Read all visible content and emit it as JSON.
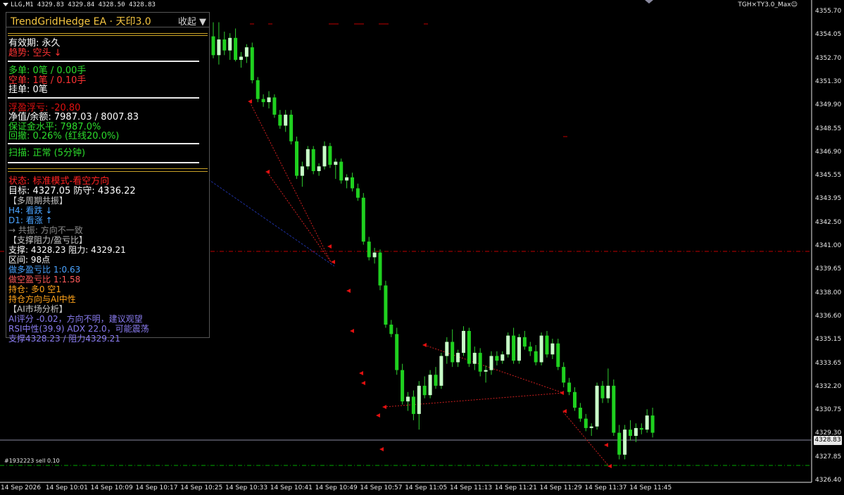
{
  "window": {
    "symbol_line": "LLG,M1  4329.83 4329.84 4328.50 4328.83",
    "indicator_label": "TGH×TY3.0_Max☺"
  },
  "colors": {
    "background": "#000000",
    "bull_candle": "#c8ffc8",
    "bear_candle": "#1fd11f",
    "wick": "#2ecc2e",
    "axis": "#e8e8e8",
    "price_line": "#8a8aa0",
    "order_red": "#c00000",
    "order_green": "#00aa00",
    "trend_blue": "#1d2f9e",
    "trade_red": "#d11f1f",
    "panel_gold": "#f4c542"
  },
  "panel": {
    "title": "TrendGridHedge EA · 天印3.0",
    "collapse_label": "收起 ▼",
    "lines": [
      {
        "text": "有效期: 永久",
        "color": "#ffffff"
      },
      {
        "text": "趋势: 空头 ↓",
        "color": "#ff3333"
      },
      {
        "text": "多单: 0笔 / 0.00手",
        "color": "#2cdc2c"
      },
      {
        "text": "空单: 1笔 / 0.10手",
        "color": "#ff3333"
      },
      {
        "text": "挂单: 0笔",
        "color": "#ffffff"
      },
      {
        "text": "浮盈浮亏: -20.80",
        "color": "#e01010"
      },
      {
        "text": "净值/余额: 7987.03 / 8007.83",
        "color": "#ffffff"
      },
      {
        "text": "保证金水平: 7987.0%",
        "color": "#2cdc2c"
      },
      {
        "text": "回撤: 0.26% (红线20.0%)",
        "color": "#2cdc2c"
      },
      {
        "text": "扫描: 正常 (5分钟)",
        "color": "#2cdc2c"
      },
      {
        "text": "状态: 标准模式-看空方向",
        "color": "#ff2222"
      },
      {
        "text": "目标: 4327.05  防守: 4336.22",
        "color": "#ffffff"
      },
      {
        "text": "【多周期共振】",
        "color": "#c8c8c8"
      },
      {
        "text": "H4: 看跌 ↓",
        "color": "#4aa3ff"
      },
      {
        "text": "D1: 看涨 ↑",
        "color": "#4aa3ff"
      },
      {
        "text": "→ 共振: 方向不一致",
        "color": "#8c8c8c"
      },
      {
        "text": "【支撑阻力/盈亏比】",
        "color": "#c8c8c8"
      },
      {
        "text": "支撑: 4328.23  阻力: 4329.21",
        "color": "#ffffff"
      },
      {
        "text": "区间: 98点",
        "color": "#ffffff"
      },
      {
        "text": "做多盈亏比  1:0.63",
        "color": "#4aa3ff"
      },
      {
        "text": "做空盈亏比  1:1.58",
        "color": "#ff5a5a"
      },
      {
        "text": "持仓: 多0 空1",
        "color": "#ffa31a"
      },
      {
        "text": "持仓方向与AI中性",
        "color": "#ffa31a"
      },
      {
        "text": "【AI市场分析】",
        "color": "#c8c8c8"
      },
      {
        "text": "AI评分 -0.02，方向不明，建议观望",
        "color": "#8a7cf0"
      },
      {
        "text": "RSI中性(39.9)  ADX 22.0，可能震荡",
        "color": "#8a7cf0"
      },
      {
        "text": "支撑4328.23 / 阻力4329.21",
        "color": "#8a7cf0"
      }
    ]
  },
  "y_axis": {
    "labels": [
      "4355.70",
      "4354.05",
      "4352.70",
      "4351.30",
      "4349.90",
      "4348.55",
      "4346.90",
      "4345.55",
      "4343.95",
      "4342.50",
      "4341.00",
      "4339.65",
      "4338.00",
      "4336.60",
      "4335.15",
      "4333.65",
      "4332.20",
      "4330.75",
      "4329.30",
      "4327.85",
      "4326.40"
    ]
  },
  "x_axis": {
    "labels": [
      "14 Sep 2026",
      "14 Sep 10:01",
      "14 Sep 10:09",
      "14 Sep 10:17",
      "14 Sep 10:25",
      "14 Sep 10:33",
      "14 Sep 10:41",
      "14 Sep 10:49",
      "14 Sep 10:57",
      "14 Sep 11:05",
      "14 Sep 11:13",
      "14 Sep 11:21",
      "14 Sep 11:29",
      "14 Sep 11:37",
      "14 Sep 11:45"
    ]
  },
  "current_price": "4328.83",
  "order_label": "#1932223 sell 0.10",
  "candles": [
    [
      4354.1,
      4355.0,
      4352.7,
      4352.9
    ],
    [
      4352.9,
      4355.0,
      4352.3,
      4353.9
    ],
    [
      4353.9,
      4354.4,
      4352.9,
      4353.2
    ],
    [
      4353.2,
      4354.3,
      4352.6,
      4354.0
    ],
    [
      4354.0,
      4354.6,
      4352.5,
      4352.6
    ],
    [
      4352.6,
      4353.1,
      4352.1,
      4352.8
    ],
    [
      4352.8,
      4353.6,
      4352.4,
      4353.4
    ],
    [
      4353.4,
      4353.7,
      4351.1,
      4351.3
    ],
    [
      4351.3,
      4351.5,
      4349.9,
      4350.1
    ],
    [
      4350.1,
      4350.4,
      4349.6,
      4349.9
    ],
    [
      4349.9,
      4350.6,
      4349.5,
      4350.2
    ],
    [
      4350.2,
      4350.4,
      4348.9,
      4349.1
    ],
    [
      4349.1,
      4349.4,
      4348.2,
      4348.4
    ],
    [
      4348.4,
      4349.4,
      4348.0,
      4349.1
    ],
    [
      4349.1,
      4349.4,
      4347.2,
      4347.4
    ],
    [
      4347.4,
      4347.7,
      4345.0,
      4345.2
    ],
    [
      4345.2,
      4346.1,
      4344.5,
      4345.8
    ],
    [
      4345.8,
      4347.1,
      4345.6,
      4346.9
    ],
    [
      4346.9,
      4347.1,
      4345.3,
      4345.5
    ],
    [
      4345.5,
      4346.0,
      4345.2,
      4345.8
    ],
    [
      4345.8,
      4347.4,
      4345.6,
      4347.1
    ],
    [
      4347.1,
      4347.3,
      4345.7,
      4345.9
    ],
    [
      4345.9,
      4346.3,
      4345.0,
      4346.1
    ],
    [
      4346.1,
      4346.3,
      4344.7,
      4344.9
    ],
    [
      4344.9,
      4345.3,
      4344.4,
      4345.1
    ],
    [
      4345.1,
      4345.4,
      4344.2,
      4344.4
    ],
    [
      4344.4,
      4344.7,
      4343.6,
      4343.8
    ],
    [
      4343.8,
      4344.1,
      4340.8,
      4341.0
    ],
    [
      4341.0,
      4341.3,
      4339.8,
      4340.0
    ],
    [
      4340.0,
      4340.6,
      4339.6,
      4340.3
    ],
    [
      4340.3,
      4340.5,
      4337.9,
      4338.2
    ],
    [
      4338.2,
      4338.5,
      4335.5,
      4335.7
    ],
    [
      4335.7,
      4336.0,
      4334.9,
      4335.1
    ],
    [
      4335.1,
      4335.5,
      4332.5,
      4332.8
    ],
    [
      4332.8,
      4333.2,
      4330.6,
      4330.8
    ],
    [
      4330.8,
      4331.4,
      4330.2,
      4331.1
    ],
    [
      4331.1,
      4331.5,
      4329.6,
      4330.0
    ],
    [
      4330.0,
      4332.1,
      4329.0,
      4331.8
    ],
    [
      4331.8,
      4332.4,
      4331.0,
      4331.2
    ],
    [
      4331.2,
      4332.8,
      4331.0,
      4332.5
    ],
    [
      4332.5,
      4333.0,
      4331.6,
      4331.8
    ],
    [
      4331.8,
      4333.9,
      4331.6,
      4333.7
    ],
    [
      4333.7,
      4334.9,
      4333.2,
      4334.6
    ],
    [
      4334.6,
      4335.4,
      4333.0,
      4333.3
    ],
    [
      4333.3,
      4334.1,
      4333.0,
      4333.9
    ],
    [
      4333.9,
      4335.6,
      4333.7,
      4335.3
    ],
    [
      4335.3,
      4335.5,
      4333.0,
      4333.2
    ],
    [
      4333.2,
      4334.3,
      4332.8,
      4333.9
    ],
    [
      4333.9,
      4334.2,
      4332.4,
      4332.7
    ],
    [
      4332.7,
      4333.1,
      4332.0,
      4332.8
    ],
    [
      4332.8,
      4334.0,
      4332.5,
      4333.7
    ],
    [
      4333.7,
      4334.0,
      4333.1,
      4333.4
    ],
    [
      4333.4,
      4334.0,
      4333.2,
      4333.8
    ],
    [
      4333.8,
      4335.2,
      4333.6,
      4335.0
    ],
    [
      4335.0,
      4335.5,
      4333.2,
      4333.4
    ],
    [
      4333.4,
      4335.1,
      4333.2,
      4334.9
    ],
    [
      4334.9,
      4335.3,
      4334.1,
      4334.3
    ],
    [
      4334.3,
      4334.6,
      4333.7,
      4334.0
    ],
    [
      4334.0,
      4334.4,
      4333.1,
      4333.3
    ],
    [
      4333.3,
      4335.2,
      4333.1,
      4335.0
    ],
    [
      4335.0,
      4335.3,
      4333.6,
      4333.8
    ],
    [
      4333.8,
      4334.8,
      4333.5,
      4334.5
    ],
    [
      4334.5,
      4334.8,
      4332.8,
      4333.0
    ],
    [
      4333.0,
      4333.3,
      4331.7,
      4332.0
    ],
    [
      4332.0,
      4332.3,
      4331.2,
      4331.4
    ],
    [
      4331.4,
      4331.7,
      4330.2,
      4330.4
    ],
    [
      4330.4,
      4330.7,
      4329.5,
      4329.7
    ],
    [
      4329.7,
      4330.0,
      4328.9,
      4329.1
    ],
    [
      4329.1,
      4329.4,
      4328.6,
      4329.2
    ],
    [
      4329.2,
      4332.0,
      4329.0,
      4331.8
    ],
    [
      4331.8,
      4332.1,
      4330.7,
      4331.0
    ],
    [
      4331.0,
      4332.9,
      4330.7,
      4331.8
    ],
    [
      4331.8,
      4332.2,
      4328.6,
      4328.8
    ],
    [
      4328.8,
      4329.3,
      4327.1,
      4327.4
    ],
    [
      4327.4,
      4329.3,
      4327.1,
      4329.0
    ],
    [
      4329.0,
      4329.6,
      4328.3,
      4328.6
    ],
    [
      4328.6,
      4329.4,
      4328.2,
      4329.1
    ],
    [
      4329.1,
      4329.4,
      4328.7,
      4329.0
    ],
    [
      4329.0,
      4330.3,
      4328.8,
      4329.9
    ],
    [
      4329.9,
      4330.4,
      4328.5,
      4328.8
    ]
  ]
}
